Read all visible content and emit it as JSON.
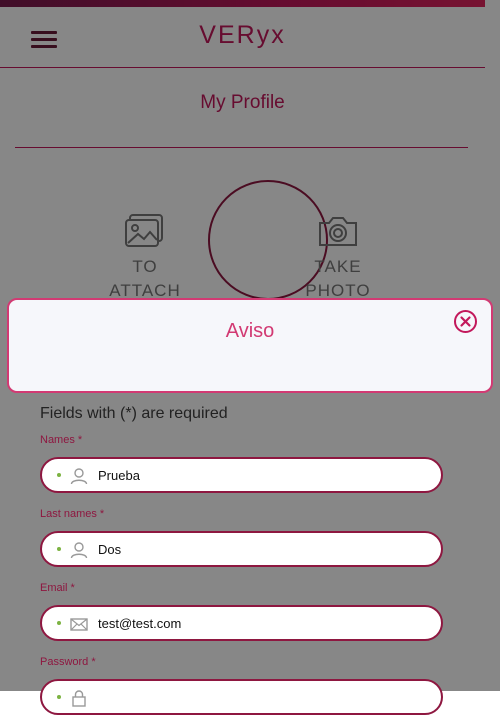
{
  "app": {
    "brand": "VERyx",
    "page_title": "My Profile"
  },
  "photo_actions": {
    "attach_label_line1": "TO",
    "attach_label_line2": "ATTACH",
    "photo_label_line1": "TAKE",
    "photo_label_line2": "PHOTO"
  },
  "modal": {
    "title": "Aviso"
  },
  "form": {
    "required_note": "Fields with (*) are required",
    "fields": [
      {
        "label": "Names *",
        "value": "Prueba",
        "icon": "person-icon"
      },
      {
        "label": "Last names *",
        "value": "Dos",
        "icon": "person-icon"
      },
      {
        "label": "Email *",
        "value": "test@test.com",
        "icon": "envelope-icon"
      },
      {
        "label": "Password *",
        "value": "",
        "icon": "lock-icon"
      }
    ]
  },
  "colors": {
    "accent": "#c2185b",
    "border": "#8e1740",
    "indicator": "#7cb342"
  }
}
